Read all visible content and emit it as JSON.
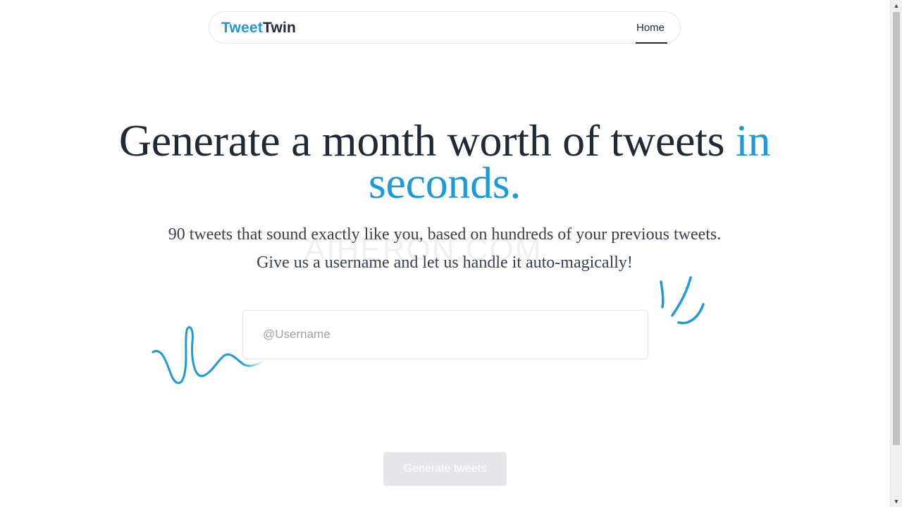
{
  "header": {
    "logo_part1": "Tweet",
    "logo_part2": "Twin",
    "nav_home": "Home"
  },
  "hero": {
    "headline_main": "Generate a month worth of tweets ",
    "headline_accent_1": "in",
    "headline_accent_2": "seconds.",
    "subline_1": "90 tweets that sound exactly like you, based on hundreds of your previous tweets.",
    "subline_2": "Give us a username and let us handle it auto-magically!",
    "watermark": "AIHERON.COM"
  },
  "form": {
    "username_placeholder": "@Username",
    "username_value": "",
    "generate_label": "Generate tweets"
  },
  "colors": {
    "accent": "#1d9bd9",
    "text_dark": "#1f2937",
    "button_disabled_bg": "#e5e7eb"
  },
  "icons": {
    "left_decoration": "squiggle-doodle-icon",
    "right_decoration": "sparkle-lines-icon"
  }
}
